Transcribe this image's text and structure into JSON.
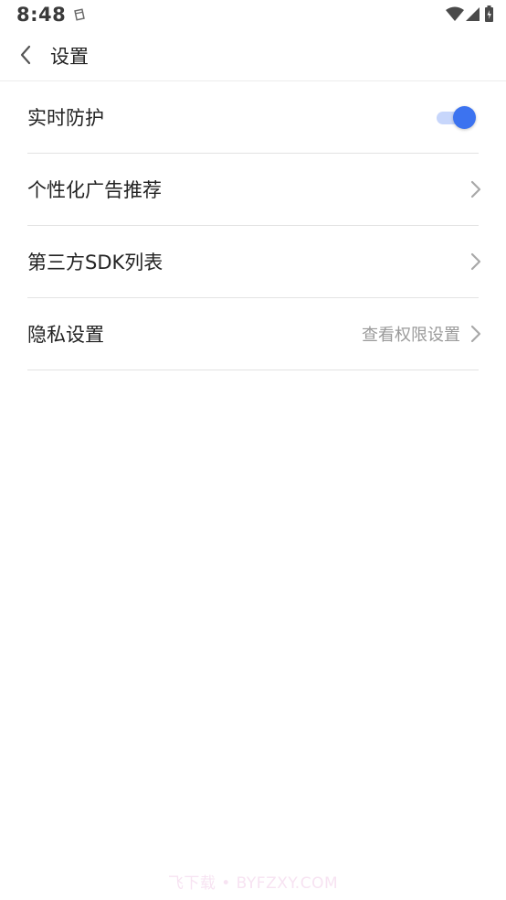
{
  "status_bar": {
    "time": "8:48",
    "icons": [
      "notification-icon",
      "wifi-icon",
      "signal-icon",
      "battery-icon"
    ]
  },
  "header": {
    "title": "设置",
    "back_icon": "chevron-left-icon"
  },
  "settings": [
    {
      "label": "实时防护",
      "control": "toggle",
      "enabled": true
    },
    {
      "label": "个性化广告推荐",
      "control": "chevron"
    },
    {
      "label": "第三方SDK列表",
      "control": "chevron"
    },
    {
      "label": "隐私设置",
      "value": "查看权限设置",
      "control": "chevron"
    }
  ],
  "watermark": "飞下载 • BYFZXY.COM",
  "colors": {
    "accent": "#3c73f0",
    "accent_track": "#c7d6fb",
    "divider": "#e3e3e3",
    "secondary_text": "#9a9a9a"
  }
}
